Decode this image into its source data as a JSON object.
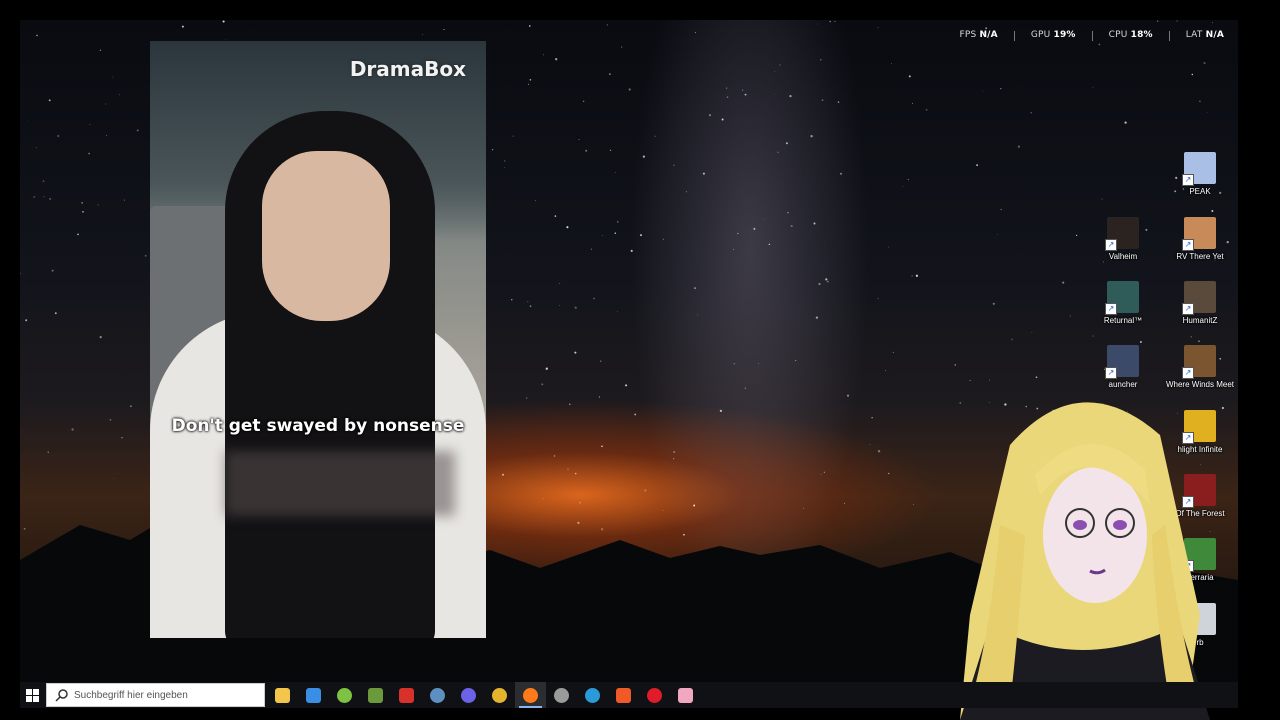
{
  "overlay": {
    "fps_label": "FPS",
    "fps_value": "N/A",
    "gpu_label": "GPU",
    "gpu_value": "19%",
    "cpu_label": "CPU",
    "cpu_value": "18%",
    "lat_label": "LAT",
    "lat_value": "N/A"
  },
  "video": {
    "brand": "DramaBox",
    "subtitle": "Don't get swayed by nonsense"
  },
  "desktop_icons": [
    {
      "label": "PEAK",
      "icon": "peak-icon",
      "color": "#a9bfe6"
    },
    {
      "label": "Valheim",
      "icon": "valheim-icon",
      "color": "#2a2320"
    },
    {
      "label": "RV There Yet",
      "icon": "rv-there-yet-icon",
      "color": "#c98a5a"
    },
    {
      "label": "Returnal™",
      "icon": "returnal-icon",
      "color": "#2f5c58"
    },
    {
      "label": "HumanitZ",
      "icon": "humanitz-icon",
      "color": "#5a4a3c"
    },
    {
      "label": "auncher",
      "icon": "launcher-icon",
      "color": "#3a4a68"
    },
    {
      "label": "Where Winds Meet",
      "icon": "where-winds-meet-icon",
      "color": "#7a5530"
    },
    {
      "label": "hlight Infinite",
      "icon": "torchlight-infinite-icon",
      "color": "#e0b020"
    },
    {
      "label": "Of The Forest",
      "icon": "sons-of-the-forest-icon",
      "color": "#8a1e1e"
    },
    {
      "label": "Terraria",
      "icon": "terraria-icon",
      "color": "#3f8a3a"
    },
    {
      "label": "rb",
      "icon": "recycle-bin-icon",
      "color": "#cfd4da"
    }
  ],
  "taskbar": {
    "search_placeholder": "Suchbegriff hier eingeben",
    "apps": [
      {
        "name": "file-explorer-icon",
        "color": "#f3c54a"
      },
      {
        "name": "microsoft-store-icon",
        "color": "#3a8ee6"
      },
      {
        "name": "android-app-icon",
        "color": "#7dc242"
      },
      {
        "name": "minecraft-icon",
        "color": "#6a9a3c"
      },
      {
        "name": "red-app-icon",
        "color": "#d8302a"
      },
      {
        "name": "steam-icon",
        "color": "#5d8fc0"
      },
      {
        "name": "discord-icon",
        "color": "#6b62e8"
      },
      {
        "name": "chrome-icon",
        "color": "#e4b52c"
      },
      {
        "name": "firefox-icon",
        "color": "#ff7a1a"
      },
      {
        "name": "speedometer-icon",
        "color": "#9a9a9a"
      },
      {
        "name": "swirl-app-icon",
        "color": "#2a9ad8"
      },
      {
        "name": "brave-icon",
        "color": "#f05a26"
      },
      {
        "name": "opera-icon",
        "color": "#e01b2a"
      },
      {
        "name": "pink-app-icon",
        "color": "#f2a7c0"
      }
    ]
  }
}
